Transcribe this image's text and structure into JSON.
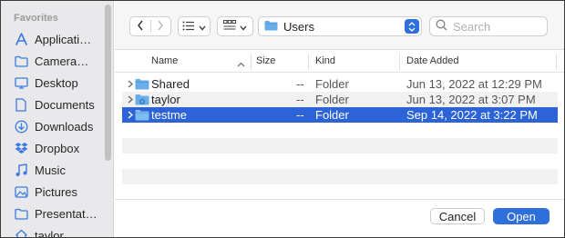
{
  "sidebar": {
    "section_title": "Favorites",
    "items": [
      {
        "label": "Applicati…",
        "icon": "applications-icon"
      },
      {
        "label": "Camera…",
        "icon": "folder-icon"
      },
      {
        "label": "Desktop",
        "icon": "desktop-icon"
      },
      {
        "label": "Documents",
        "icon": "document-icon"
      },
      {
        "label": "Downloads",
        "icon": "downloads-icon"
      },
      {
        "label": "Dropbox",
        "icon": "dropbox-icon"
      },
      {
        "label": "Music",
        "icon": "music-icon"
      },
      {
        "label": "Pictures",
        "icon": "pictures-icon"
      },
      {
        "label": "Presentat…",
        "icon": "folder-icon"
      },
      {
        "label": "taylor",
        "icon": "home-icon"
      }
    ]
  },
  "toolbar": {
    "path_label": "Users",
    "search_placeholder": "Search"
  },
  "columns": {
    "name": "Name",
    "size": "Size",
    "kind": "Kind",
    "date": "Date Added"
  },
  "files": [
    {
      "name": "Shared",
      "size": "--",
      "kind": "Folder",
      "date": "Jun 13, 2022 at 12:29 PM",
      "selected": false
    },
    {
      "name": "taylor",
      "size": "--",
      "kind": "Folder",
      "date": "Jun 13, 2022 at 3:07 PM",
      "selected": false
    },
    {
      "name": "testme",
      "size": "--",
      "kind": "Folder",
      "date": "Sep 14, 2022 at 3:22 PM",
      "selected": true
    }
  ],
  "buttons": {
    "cancel": "Cancel",
    "open": "Open"
  },
  "colors": {
    "accent": "#2f6fdb",
    "selection": "#2c63d6",
    "sidebar_icon": "#3b7be0"
  }
}
